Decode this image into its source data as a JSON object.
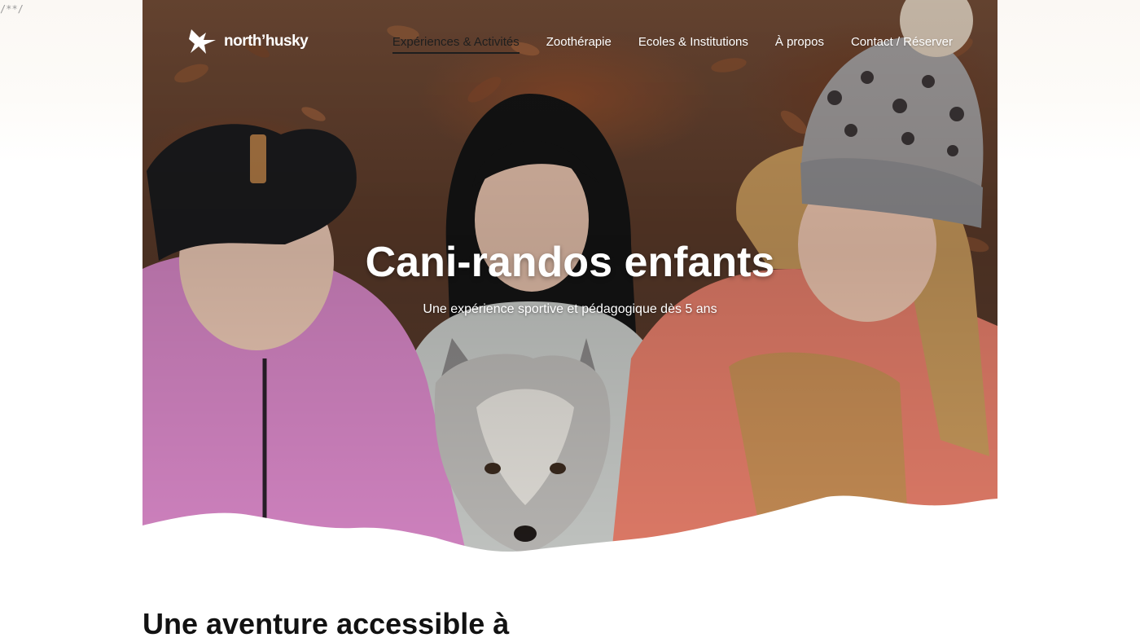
{
  "stray_text": "/**/",
  "brand": {
    "name": "north’husky",
    "logo_icon": "husky-star-logo-icon"
  },
  "nav": {
    "items": [
      {
        "label": "Expériences & Activités",
        "active": true
      },
      {
        "label": "Zoothérapie",
        "active": false
      },
      {
        "label": "Ecoles & Institutions",
        "active": false
      },
      {
        "label": "À propos",
        "active": false
      },
      {
        "label": "Contact / Réserver",
        "active": false
      }
    ]
  },
  "hero": {
    "title": "Cani-randos enfants",
    "subtitle": "Une expérience sportive et pédagogique dès 5 ans"
  },
  "section": {
    "title": "Une aventure accessible à"
  },
  "colors": {
    "nav_text": "#ffffff",
    "nav_active": "#1e1e1e",
    "heading": "#121212"
  }
}
